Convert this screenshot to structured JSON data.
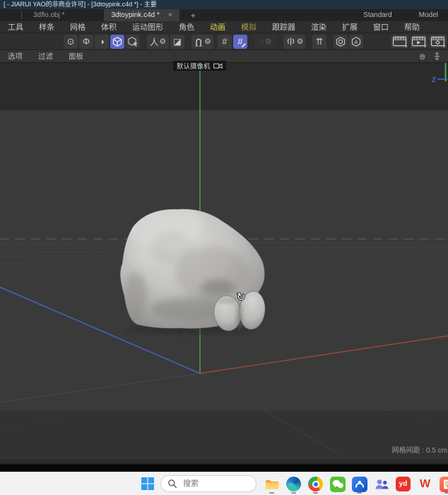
{
  "window": {
    "title": "[ - JIARUI YAO的非商业许可]  - [3dtoypink.c4d *] - 主要"
  },
  "tabs": {
    "items": [
      {
        "label": "3dflo.obj *"
      },
      {
        "label": "3dtoypink.c4d *",
        "close": "×"
      }
    ],
    "add_label": "+",
    "layout_label": "Standard",
    "mode_label": "Model"
  },
  "menus": {
    "items": [
      {
        "label": "工具"
      },
      {
        "label": "样条"
      },
      {
        "label": "网格"
      },
      {
        "label": "体积"
      },
      {
        "label": "运动图形"
      },
      {
        "label": "角色"
      },
      {
        "label": "动画",
        "color": "#e6d44a"
      },
      {
        "label": "模拟",
        "color": "#a59b45"
      },
      {
        "label": "跟踪器"
      },
      {
        "label": "渲染"
      },
      {
        "label": "扩展"
      },
      {
        "label": "窗口"
      },
      {
        "label": "帮助"
      }
    ]
  },
  "toolbar": {
    "buttons": [
      {
        "name": "live-selection",
        "glyph": "⊙"
      },
      {
        "name": "axis-mode",
        "glyph": "Φ"
      },
      {
        "name": "texture-mode",
        "glyph": "◑"
      },
      {
        "name": "model-mode",
        "icon": "cube",
        "active": true
      },
      {
        "name": "object-mode",
        "icon": "cube-pointer"
      },
      {
        "name": "hierarchy-tool",
        "glyph": "人",
        "glyph2": "⚙"
      },
      {
        "name": "workplane-mode",
        "glyph": "◪"
      },
      {
        "name": "snap-settings",
        "icon": "magnet",
        "glyph2": "⚙"
      },
      {
        "name": "grid",
        "glyph": "#"
      },
      {
        "name": "grid-edit",
        "glyph": "#",
        "icon2": "pencil",
        "active": true
      },
      {
        "name": "radial-tool",
        "glyph": "◌",
        "glyph2": "⚙",
        "disabled": true
      },
      {
        "name": "split-tool",
        "icon": "knife",
        "glyph2": "⚙"
      },
      {
        "name": "exchange",
        "glyph": "⇈"
      },
      {
        "name": "poly-object",
        "icon": "hex-circle"
      },
      {
        "name": "poly-axis",
        "icon": "hex-a"
      },
      {
        "name": "render-view",
        "icon": "render"
      },
      {
        "name": "render-picture-viewer",
        "icon": "render-play"
      },
      {
        "name": "render-settings",
        "icon": "render-gear"
      }
    ]
  },
  "viewport_menu": {
    "items": [
      {
        "label": "选项"
      },
      {
        "label": "过滤"
      },
      {
        "label": "面板"
      }
    ]
  },
  "viewport": {
    "camera_label": "默认摄像机",
    "axis_z_label": "Z",
    "grid_spacing": "网格间距 : 0.5 cm",
    "cursor_glyph": "↻",
    "axis_colors": {
      "x": "#b2473f",
      "y": "#4aa34f",
      "z": "#3f6cd0"
    }
  },
  "taskbar": {
    "search_placeholder": "搜索",
    "apps": [
      {
        "name": "file-explorer",
        "running": true
      },
      {
        "name": "edge",
        "running": true
      },
      {
        "name": "chrome",
        "running": true
      },
      {
        "name": "wechat",
        "running": false
      },
      {
        "name": "cloud-drive",
        "running": true
      },
      {
        "name": "teams",
        "running": false
      },
      {
        "name": "youdao",
        "label": "yd",
        "running": false
      },
      {
        "name": "wps",
        "label": "W",
        "running": false
      },
      {
        "name": "docs-tool",
        "running": true
      }
    ]
  },
  "colors": {
    "active_tool_bg": "#5d68c4",
    "titlebar_bg": "#1d3340",
    "viewport_bg": "#3a3a3a",
    "taskbar_bg": "#f1f2f4",
    "menu_highlight": "#e6d44a",
    "menu_highlight_dim": "#a59b45"
  }
}
